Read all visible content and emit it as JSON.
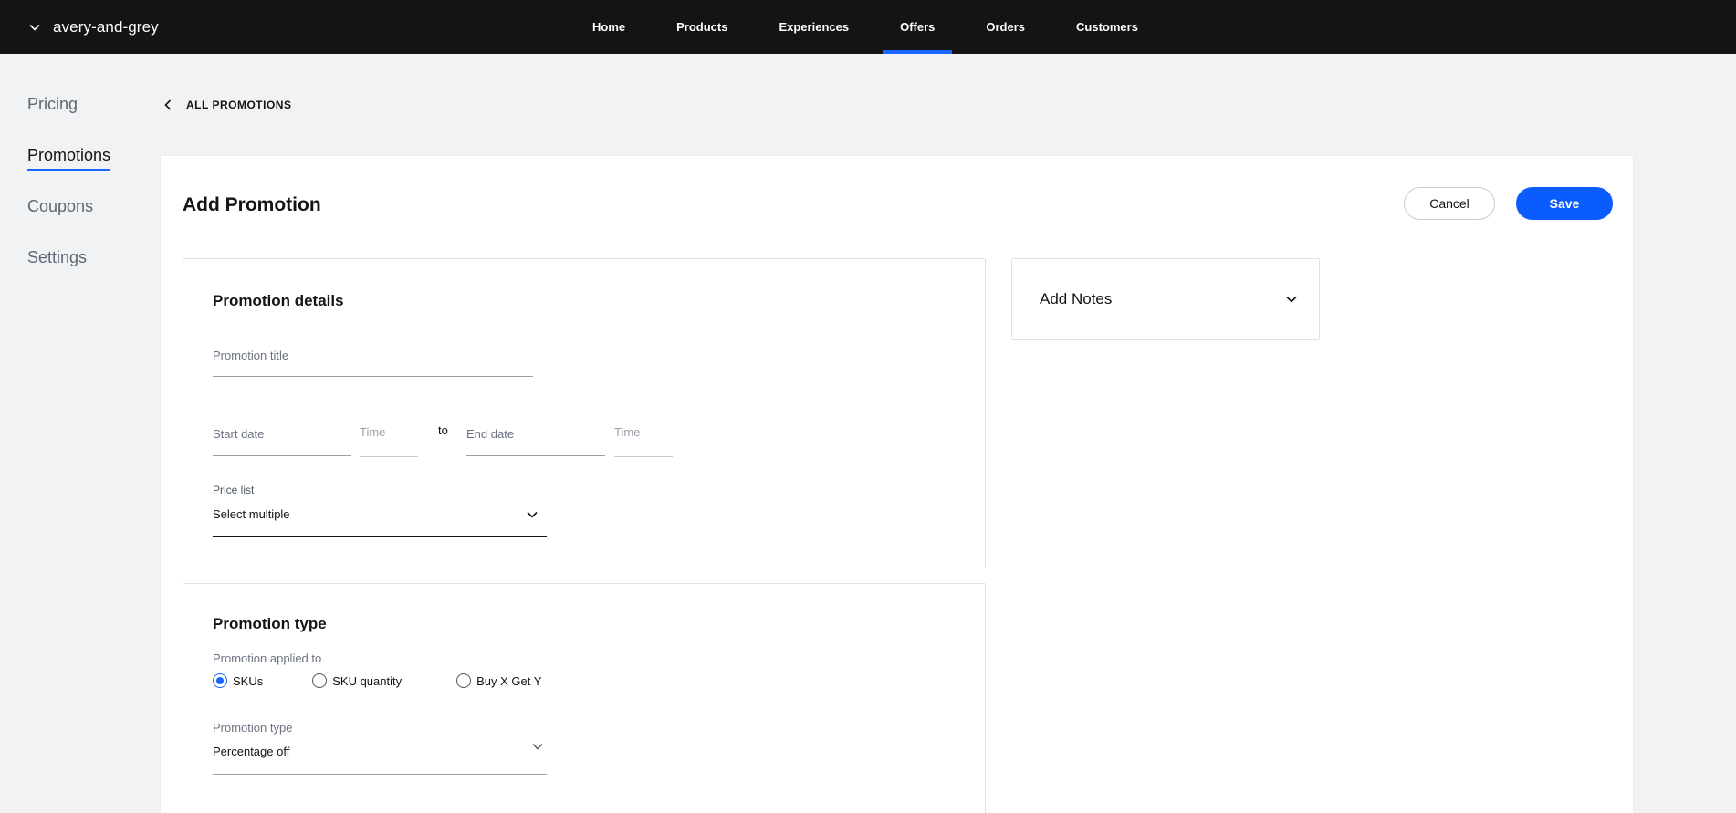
{
  "topbar": {
    "store_name": "avery-and-grey",
    "nav": [
      "Home",
      "Products",
      "Experiences",
      "Offers",
      "Orders",
      "Customers"
    ],
    "active_nav": "Offers",
    "accent": "#1a66ff"
  },
  "sidebar": {
    "items": [
      "Pricing",
      "Promotions",
      "Coupons",
      "Settings"
    ],
    "active": "Promotions"
  },
  "breadcrumb": {
    "label": "ALL PROMOTIONS"
  },
  "page": {
    "title": "Add Promotion",
    "cancel_label": "Cancel",
    "save_label": "Save",
    "save_color": "#0b5cff"
  },
  "details": {
    "title": "Promotion details",
    "promotion_title_label": "Promotion title",
    "start_date_label": "Start date",
    "start_time_label": "Time",
    "to_label": "to",
    "end_date_label": "End date",
    "end_time_label": "Time",
    "price_list_label": "Price list",
    "price_list_value": "Select multiple"
  },
  "type": {
    "title": "Promotion type",
    "applied_to_label": "Promotion applied to",
    "options": [
      "SKUs",
      "SKU quantity",
      "Buy X Get Y"
    ],
    "selected_option": "SKUs",
    "promotion_type_label": "Promotion type",
    "promotion_type_value": "Percentage off"
  },
  "notes": {
    "title": "Add Notes"
  }
}
